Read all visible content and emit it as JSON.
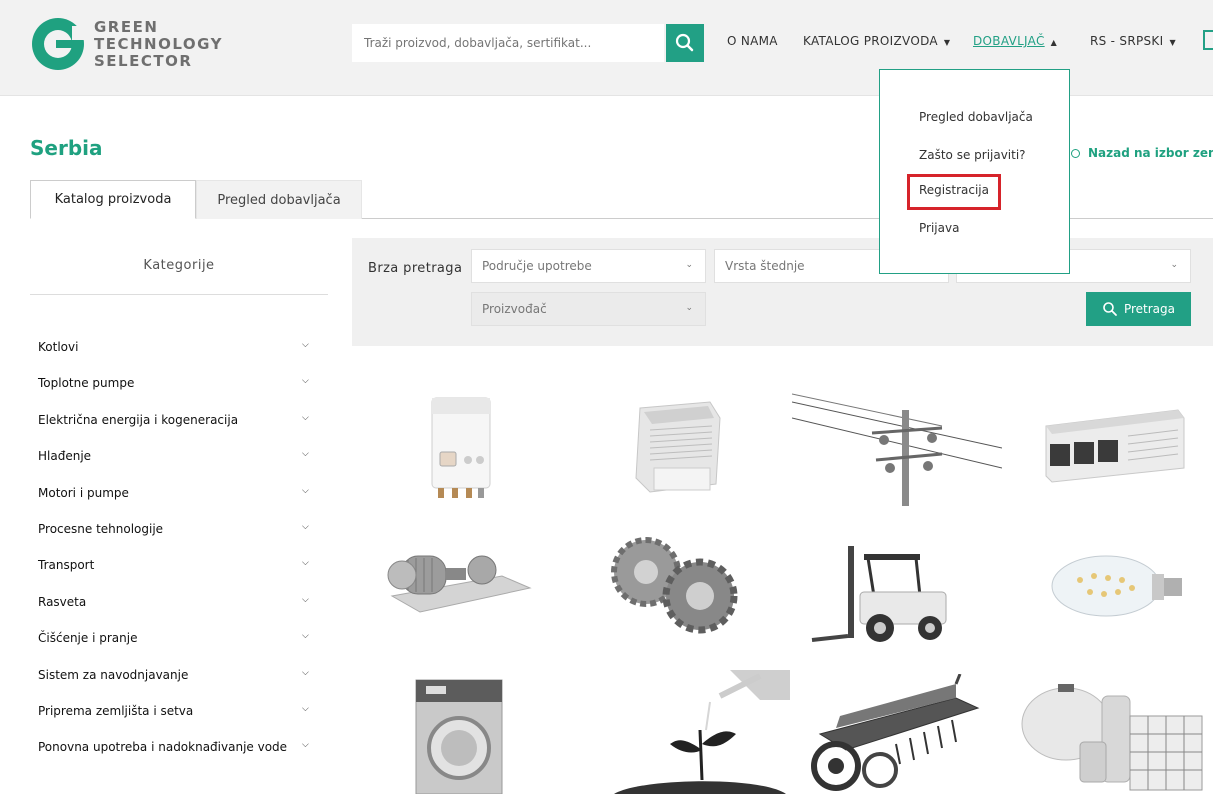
{
  "brand": {
    "line1": "GREEN",
    "line2": "TECHNOLOGY",
    "line3": "SELECTOR",
    "color": "#1fa180"
  },
  "search": {
    "placeholder": "Traži proizvod, dobavljača, sertifikat...",
    "icon": "search-icon"
  },
  "nav": {
    "o_nama": "O NAMA",
    "katalog": "KATALOG PROIZVODA",
    "dobavljac": "DOBAVLJAČ",
    "language": "RS - SRPSKI"
  },
  "dropdown": {
    "items": [
      "Pregled dobavljača",
      "Zašto se prijaviti?",
      "Registracija",
      "Prijava"
    ],
    "highlighted": "Registracija",
    "highlight_color": "#d6232a"
  },
  "page": {
    "title": "Serbia",
    "back_link": "Nazad na izbor zeml"
  },
  "tabs": [
    {
      "label": "Katalog proizvoda",
      "active": true
    },
    {
      "label": "Pregled dobavljača",
      "active": false
    }
  ],
  "sidebar": {
    "heading": "Kategorije",
    "items": [
      "Kotlovi",
      "Toplotne pumpe",
      "Električna energija i kogeneracija",
      "Hlađenje",
      "Motori i pumpe",
      "Procesne tehnologije",
      "Transport",
      "Rasveta",
      "Čišćenje i pranje",
      "Sistem za navodnjavanje",
      "Priprema zemljišta i setva",
      "Ponovna upotreba i nadoknađivanje vode"
    ]
  },
  "quick_search": {
    "label": "Brza pretraga",
    "field1": "Područje upotrebe",
    "field2": "Vrsta štednje",
    "field3": "",
    "field4": "Proizvođač",
    "button": "Pretraga"
  },
  "products": [
    {
      "icon": "gas-boiler-icon"
    },
    {
      "icon": "heat-pump-icon"
    },
    {
      "icon": "power-line-icon"
    },
    {
      "icon": "chiller-icon"
    },
    {
      "icon": "electric-motor-pump-icon"
    },
    {
      "icon": "gears-icon"
    },
    {
      "icon": "forklift-icon"
    },
    {
      "icon": "led-bulb-icon"
    },
    {
      "icon": "washing-machine-icon"
    },
    {
      "icon": "sprout-watering-icon"
    },
    {
      "icon": "seed-drill-icon"
    },
    {
      "icon": "water-tanks-icon"
    }
  ],
  "accent_color": "#22a085"
}
